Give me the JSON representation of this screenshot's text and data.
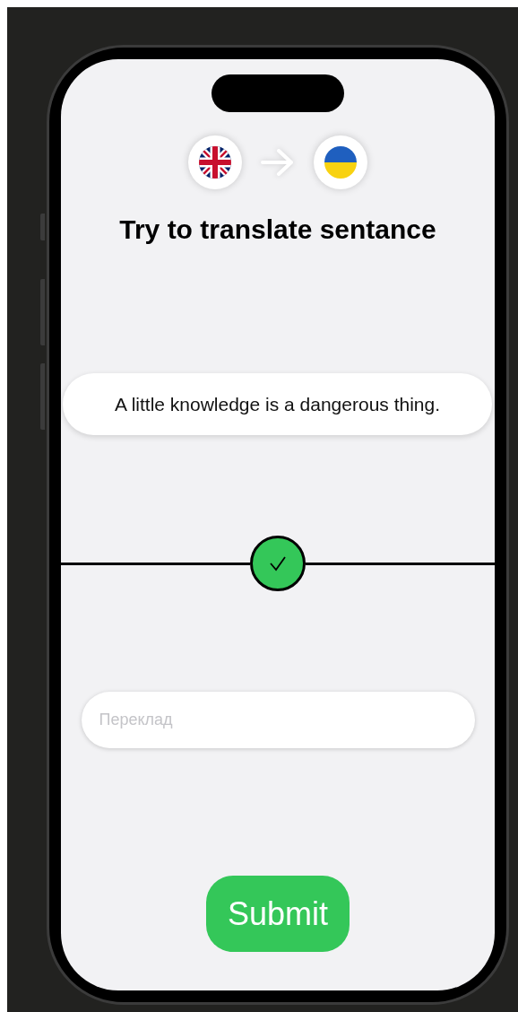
{
  "title": "Try to translate sentance",
  "sentence": "A little knowledge is a dangerous thing.",
  "result": {
    "correct": true
  },
  "answer": {
    "placeholder": "Переклад"
  },
  "submit": {
    "label": "Submit"
  }
}
